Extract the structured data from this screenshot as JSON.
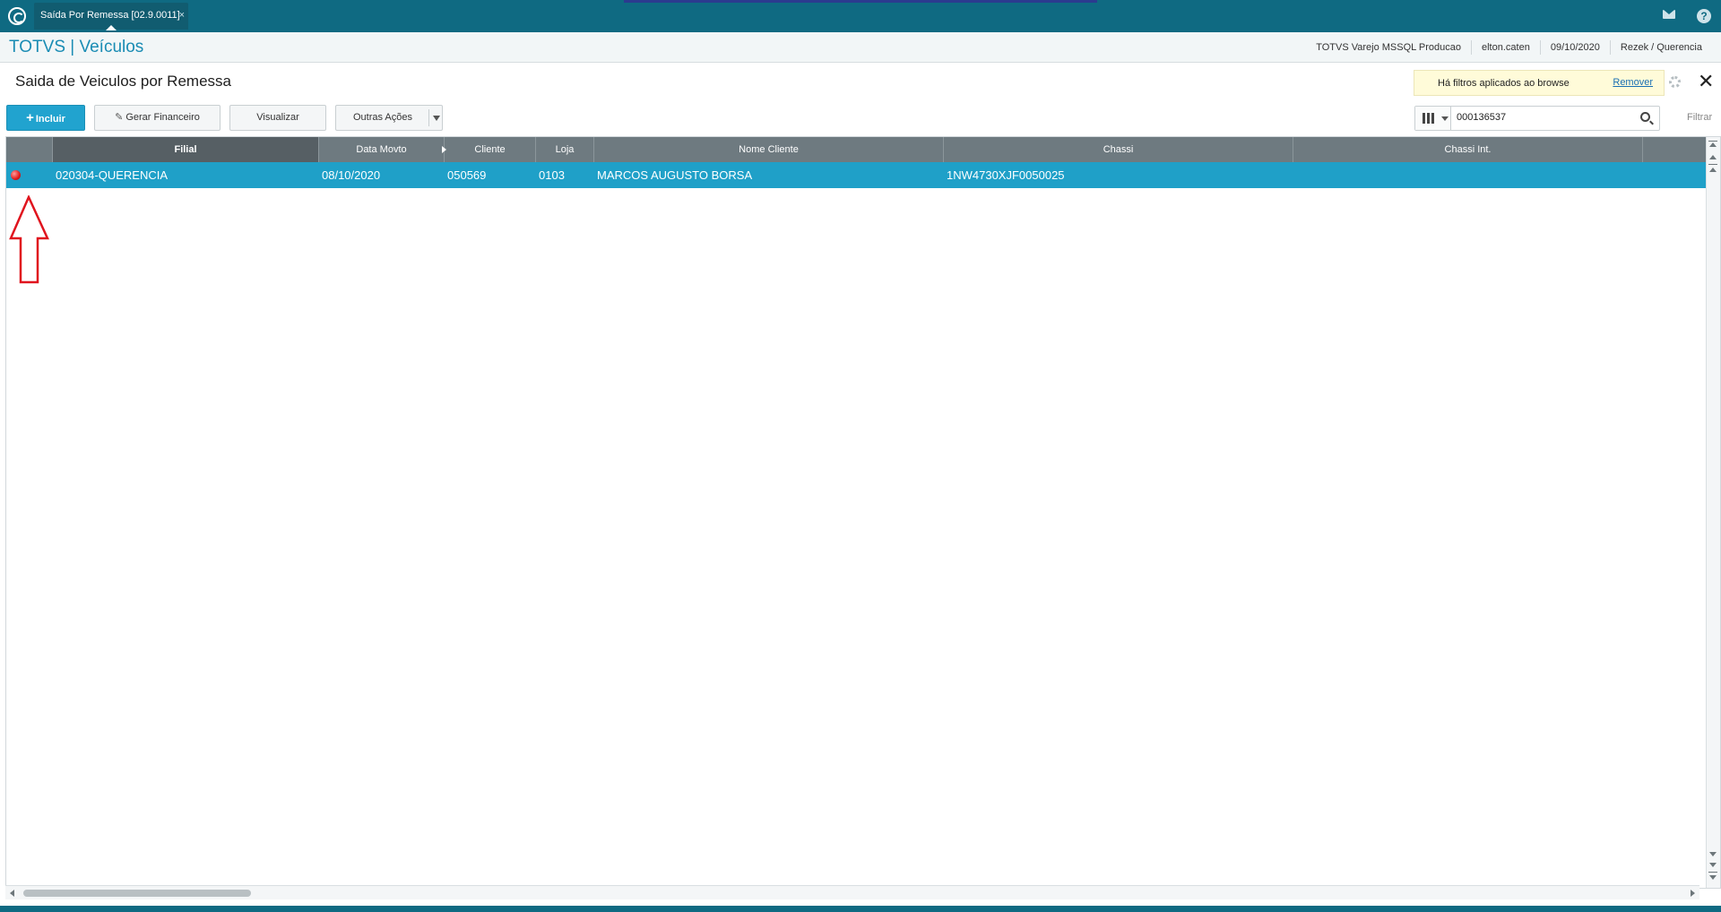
{
  "topbar": {
    "tab_label": "Saída Por Remessa [02.9.0011]",
    "tab_close": "×",
    "help_glyph": "?"
  },
  "header": {
    "brand": "TOTVS | Veículos",
    "environment": "TOTVS Varejo MSSQL Producao",
    "user": "elton.caten",
    "date": "09/10/2020",
    "company": "Rezek / Querencia"
  },
  "page": {
    "title": "Saida de Veiculos por Remessa",
    "filter_note": "Há filtros aplicados ao browse",
    "filter_remove": "Remover",
    "close_glyph": "✕"
  },
  "toolbar": {
    "incluir": "Incluir",
    "gerar_financeiro": "Gerar Financeiro",
    "visualizar": "Visualizar",
    "outras_acoes": "Outras Ações"
  },
  "search": {
    "value": "000136537",
    "filter_label": "Filtrar"
  },
  "grid": {
    "columns": [
      "",
      "Filial",
      "Data Movto",
      "Cliente",
      "Loja",
      "Nome Cliente",
      "Chassi",
      "Chassi Int."
    ],
    "rows": [
      {
        "status": "red",
        "filial": "020304-QUERENCIA",
        "data_movto": "08/10/2020",
        "cliente": "050569",
        "loja": "0103",
        "nome_cliente": "MARCOS AUGUSTO BORSA",
        "chassi": "1NW4730XJF0050025",
        "chassi_int": ""
      }
    ]
  },
  "colors": {
    "topbar": "#0f6a82",
    "brand": "#1a8cb4",
    "primary_button": "#21a3cf",
    "selected_row": "#1fa0c8",
    "header_grid": "#6e7a80",
    "annotation_arrow": "#e0141e"
  },
  "icons": [
    "totvs-logo-icon",
    "mail-icon",
    "help-icon",
    "gear-icon",
    "close-icon",
    "pencil-icon",
    "columns-icon",
    "search-icon",
    "status-red-icon"
  ]
}
